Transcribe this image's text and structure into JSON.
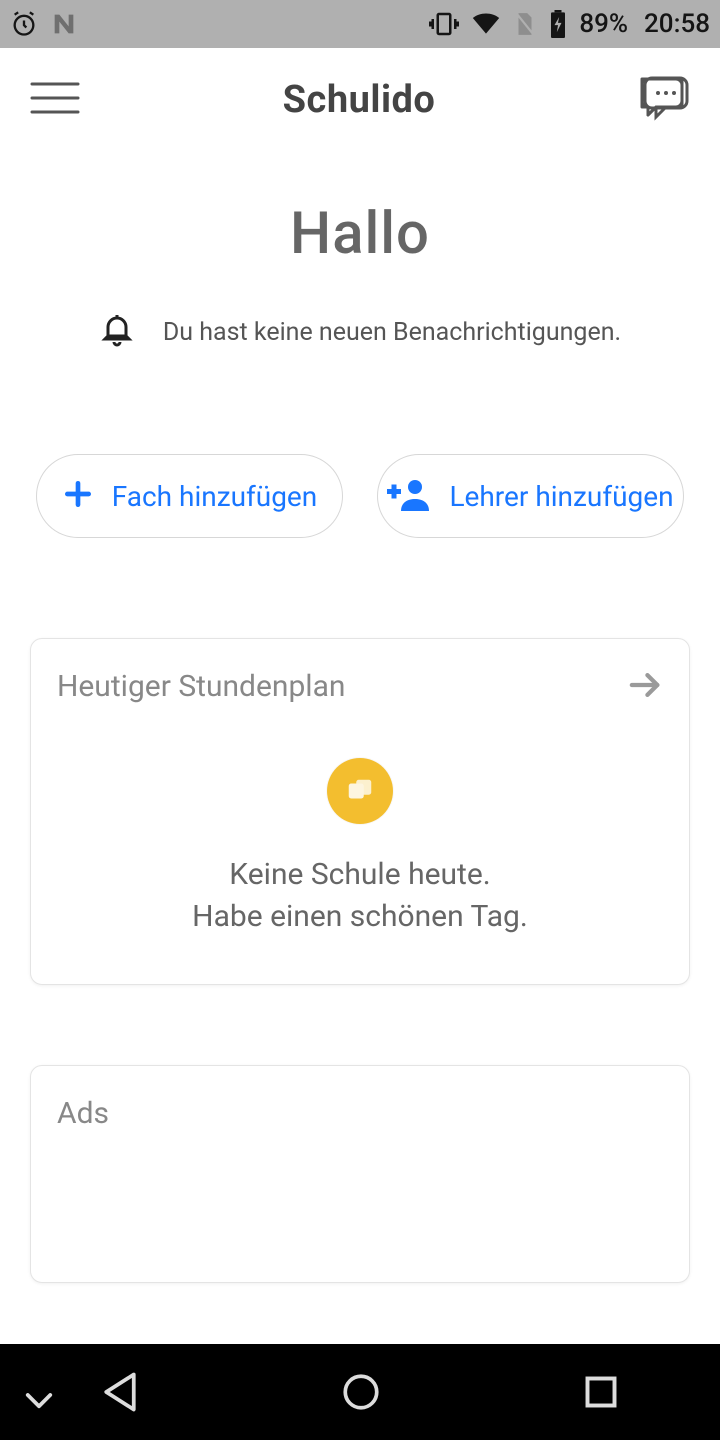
{
  "statusbar": {
    "battery_pct": "89%",
    "time": "20:58"
  },
  "header": {
    "title": "Schulido"
  },
  "hero": {
    "greeting": "Hallo",
    "notif_text": "Du hast keine neuen Benachrichtigungen."
  },
  "actions": {
    "add_subject": "Fach hinzufügen",
    "add_teacher": "Lehrer hinzufügen"
  },
  "timetable_card": {
    "title": "Heutiger Stundenplan",
    "msg_line1": "Keine Schule heute.",
    "msg_line2": "Habe einen schönen Tag."
  },
  "ads_card": {
    "title": "Ads"
  }
}
